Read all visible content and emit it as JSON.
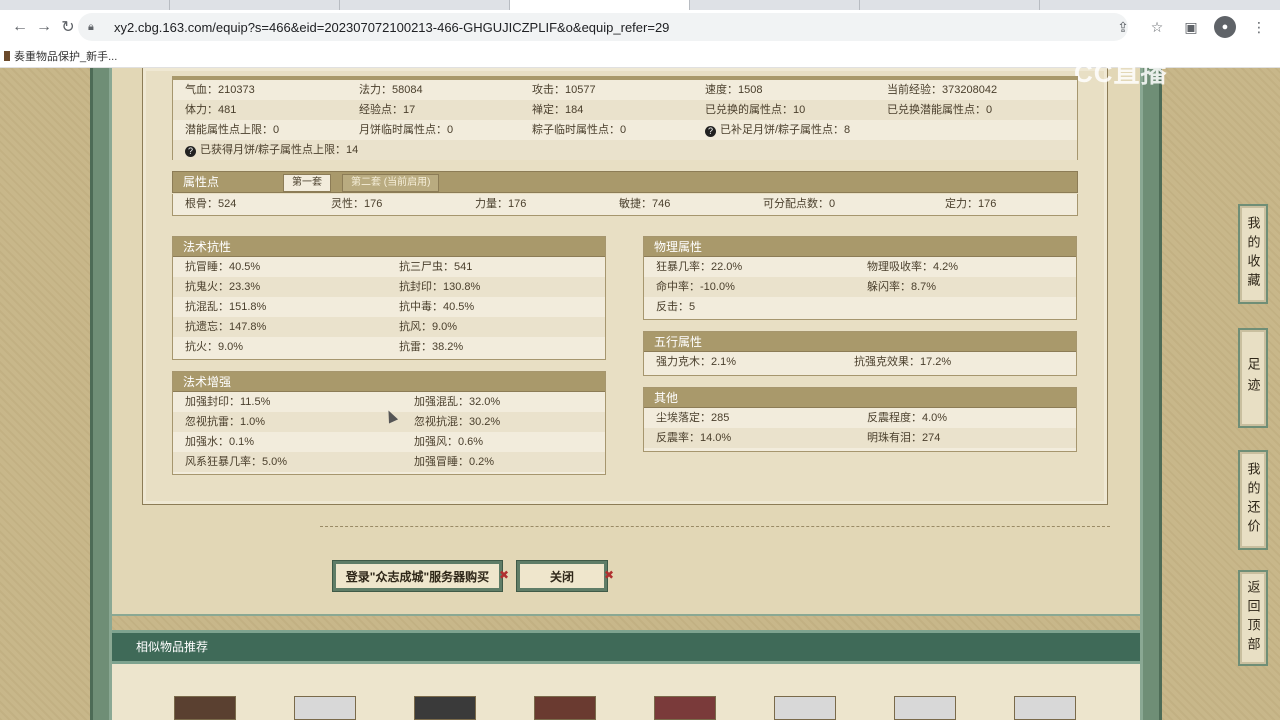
{
  "browser": {
    "url": "xy2.cbg.163.com/equip?s=466&eid=202307072100213-466-GHGUJICZPLIF&o&equip_refer=29",
    "bookmark": "奏重物品保护_新手..."
  },
  "watermark": "CC直播",
  "basic": {
    "rows": [
      [
        {
          "text": "气血：210373"
        },
        {
          "text": "法力：58084"
        },
        {
          "text": "攻击：10577"
        },
        {
          "text": "速度：1508"
        },
        {
          "text": "当前经验：373208042"
        }
      ],
      [
        {
          "text": "体力：481"
        },
        {
          "text": "经验点：17"
        },
        {
          "text": "禅定：184"
        },
        {
          "text": "已兑换的属性点：10"
        },
        {
          "text": "已兑换潜能属性点：0"
        }
      ],
      [
        {
          "text": "潜能属性点上限：0"
        },
        {
          "text": "月饼临时属性点：0"
        },
        {
          "text": "粽子临时属性点：0"
        },
        {
          "text": "已补足月饼/粽子属性点：8"
        }
      ],
      [
        {
          "text": "已获得月饼/粽子属性点上限：14"
        }
      ]
    ]
  },
  "attr": {
    "title": "属性点",
    "tab1": "第一套",
    "tab2": "第二套 (当前启用)",
    "values": [
      "根骨：524",
      "灵性：176",
      "力量：176",
      "敏捷：746",
      "可分配点数：0",
      "定力：176"
    ]
  },
  "resist": {
    "title": "法术抗性",
    "rows": [
      [
        "抗冒睡：40.5%",
        "抗三尸虫：541"
      ],
      [
        "抗鬼火：23.3%",
        "抗封印：130.8%"
      ],
      [
        "抗混乱：151.8%",
        "抗中毒：40.5%"
      ],
      [
        "抗遗忘：147.8%",
        "抗风：9.0%"
      ],
      [
        "抗火：9.0%",
        "抗雷：38.2%"
      ]
    ]
  },
  "enhance": {
    "title": "法术增强",
    "rows": [
      [
        "加强封印：11.5%",
        "加强混乱：32.0%"
      ],
      [
        "忽视抗雷：1.0%",
        "忽视抗混：30.2%"
      ],
      [
        "加强水：0.1%",
        "加强风：0.6%"
      ],
      [
        "风系狂暴几率：5.0%",
        "加强冒睡：0.2%"
      ]
    ]
  },
  "physical": {
    "title": "物理属性",
    "rows": [
      [
        "狂暴几率：22.0%",
        "物理吸收率：4.2%"
      ],
      [
        "命中率：-10.0%",
        "躲闪率：8.7%"
      ],
      [
        "反击：5",
        ""
      ]
    ]
  },
  "five": {
    "title": "五行属性",
    "rows": [
      [
        "强力克木：2.1%",
        "抗强克效果：17.2%"
      ]
    ]
  },
  "other": {
    "title": "其他",
    "rows": [
      [
        "尘埃落定：285",
        "反震程度：4.0%"
      ],
      [
        "反震率：14.0%",
        "明珠有泪：274"
      ]
    ]
  },
  "buttons": {
    "login": "登录\"众志成城\"服务器购买",
    "close": "关闭"
  },
  "recommend": {
    "title": "相似物品推荐"
  },
  "right_nav": [
    "我的收藏",
    "足迹",
    "我的还价",
    "返回顶部"
  ]
}
